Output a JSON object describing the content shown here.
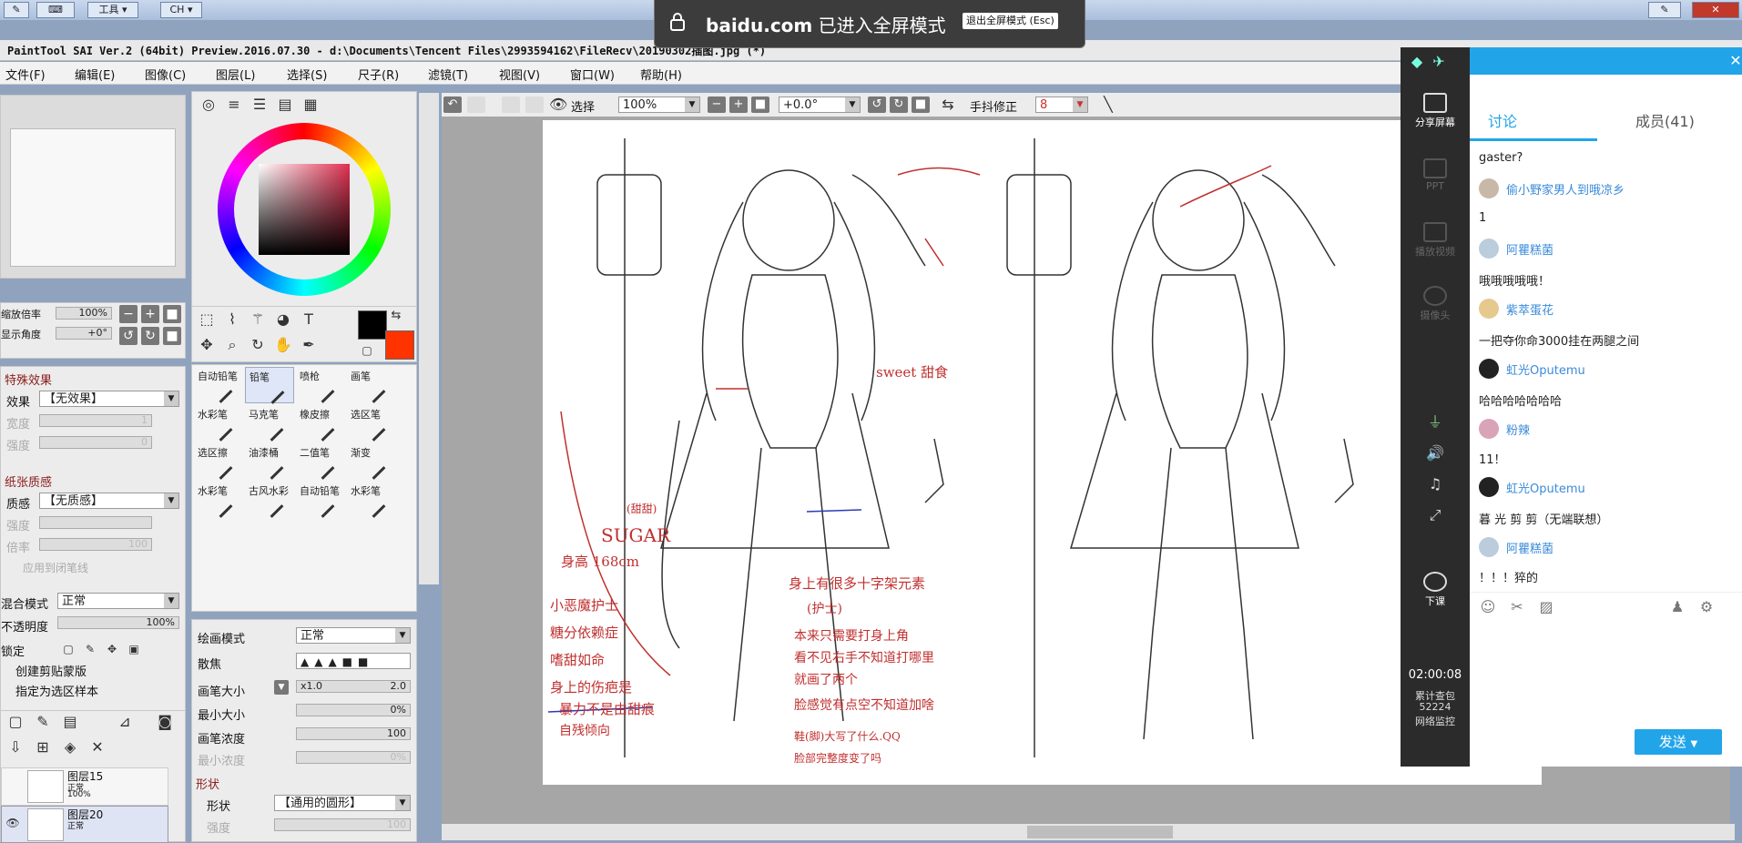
{
  "taskstrip": {
    "tools_label": "工具",
    "lang_label": "CH"
  },
  "fullscreen_notice": {
    "domain": "baidu.com",
    "message": "已进入全屏模式",
    "exit_label": "退出全屏模式 (Esc)"
  },
  "window": {
    "title": "PaintTool SAI Ver.2 (64bit) Preview.2016.07.30 - d:\\Documents\\Tencent Files\\2993594162\\FileRecv\\20190302插图.jpg (*)"
  },
  "menu": [
    "文件(F)",
    "编辑(E)",
    "图像(C)",
    "图层(L)",
    "选择(S)",
    "尺子(R)",
    "滤镜(T)",
    "视图(V)",
    "窗口(W)",
    "帮助(H)"
  ],
  "navigator": {
    "zoom_label": "缩放倍率",
    "zoom_value": "100%",
    "angle_label": "显示角度",
    "angle_value": "+0°"
  },
  "effects": {
    "section": "特殊效果",
    "effect_label": "效果",
    "effect_value": "【无效果】",
    "width_label": "宽度",
    "width_value": "1",
    "strength_label": "强度",
    "strength_value": "0"
  },
  "texture": {
    "section": "纸张质感",
    "quality_label": "质感",
    "quality_value": "【无质感】",
    "strength_label": "强度",
    "scale_label": "倍率",
    "scale_value": "100",
    "apply_label": "应用到闭笔线"
  },
  "layer_props": {
    "blend_label": "混合模式",
    "blend_value": "正常",
    "opacity_label": "不透明度",
    "opacity_value": "100%",
    "lock_label": "锁定",
    "clip_label": "创建剪贴蒙版",
    "select_label": "指定为选区样本"
  },
  "layers": [
    {
      "name": "图层15",
      "mode": "正常",
      "opacity": "100%"
    },
    {
      "name": "图层20",
      "mode": "正常",
      "opacity": ""
    }
  ],
  "brushes": [
    {
      "name": "自动铅笔"
    },
    {
      "name": "铅笔"
    },
    {
      "name": "喷枪"
    },
    {
      "name": "画笔"
    },
    {
      "name": "水彩笔"
    },
    {
      "name": "马克笔"
    },
    {
      "name": "橡皮擦"
    },
    {
      "name": "选区笔"
    },
    {
      "name": "选区擦"
    },
    {
      "name": "油漆桶"
    },
    {
      "name": "二值笔"
    },
    {
      "name": "渐变"
    },
    {
      "name": "水彩笔"
    },
    {
      "name": "古风水彩"
    },
    {
      "name": "自动铅笔"
    },
    {
      "name": "水彩笔"
    }
  ],
  "brush_settings": {
    "draw_mode_label": "绘画模式",
    "draw_mode_value": "正常",
    "focus_label": "散焦",
    "size_label": "画笔大小",
    "size_mult": "x1.0",
    "size_value": "2.0",
    "min_size_label": "最小大小",
    "min_size_value": "0%",
    "density_label": "画笔浓度",
    "density_value": "100",
    "min_density_label": "最小浓度",
    "min_density_value": "0%",
    "shape_section": "形状",
    "shape_label": "形状",
    "shape_value": "【通用的圆形】",
    "strength_label": "强度",
    "strength_value": "100"
  },
  "canvas_toolbar": {
    "select_label": "选择",
    "zoom_value": "100%",
    "angle_value": "+0.0°",
    "stabilizer_label": "手抖修正",
    "stabilizer_value": "8"
  },
  "colors": {
    "foreground": "#000000",
    "background": "#ff3300",
    "accent": "#22a4e9"
  },
  "artwork_notes": {
    "name": "(甜甜)",
    "name_en": "SUGAR",
    "height": "身高 168cm",
    "list": [
      "小恶魔护士",
      "糖分依赖症",
      "嗜甜如命",
      "身上的伤疤是"
    ],
    "wound": "暴力不是由甜痕",
    "self_harm": "自残倾向",
    "sweet": "sweet 甜食",
    "cross_note": "身上有很多十字架元素",
    "nurse": "(护士)",
    "guide": [
      "本来只需要打身上角",
      "看不见右手不知道打哪里",
      "就画了两个",
      "脸感觉有点空不知道加啥",
      "鞋(脚)大写了什么.QQ",
      "脸部完整度变了吗"
    ]
  },
  "chat": {
    "sidebar": [
      {
        "label": "分享屏幕",
        "icon": "share-screen-icon"
      },
      {
        "label": "PPT",
        "icon": "ppt-icon"
      },
      {
        "label": "播放视频",
        "icon": "play-video-icon"
      },
      {
        "label": "摄像头",
        "icon": "camera-icon"
      },
      {
        "label": "下课",
        "icon": "end-class-icon"
      }
    ],
    "timer": "02:00:08",
    "accumulated_label": "累计查包",
    "accumulated_value": "52224",
    "net_label": "网络监控",
    "tabs": {
      "discussion": "讨论",
      "members": "成员(41)"
    },
    "messages": [
      {
        "name": "",
        "text": "gaster?"
      },
      {
        "name": "偷小野家男人到哦凉乡",
        "text": "1"
      },
      {
        "name": "阿瞿糕菌",
        "text": "哦哦哦哦哦！"
      },
      {
        "name": "紫萃蛋花",
        "text": "一把夺你命3000挂在两腿之间"
      },
      {
        "name": "虹光Oputemu",
        "text": "哈哈哈哈哈哈哈"
      },
      {
        "name": "粉辣",
        "text": "11！"
      },
      {
        "name": "虹光Oputemu",
        "text": "暮 光 剪 剪（无端联想）"
      },
      {
        "name": "阿瞿糕菌",
        "text": "！！！猝的"
      }
    ],
    "send_label": "发送"
  }
}
